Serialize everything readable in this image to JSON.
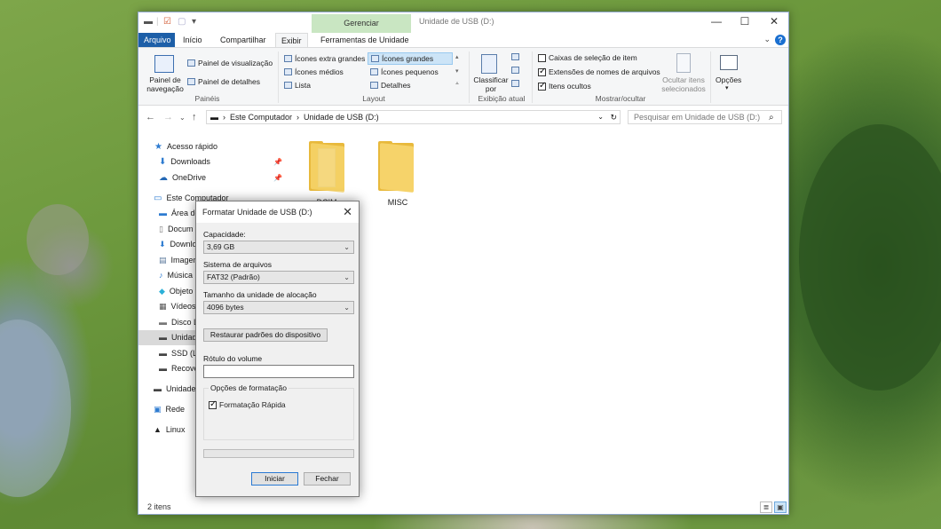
{
  "explorer": {
    "manage_tab": "Gerenciar",
    "window_title": "Unidade de USB (D:)",
    "tabs": {
      "file": "Arquivo",
      "home": "Início",
      "share": "Compartilhar",
      "view": "Exibir",
      "drive_tools": "Ferramentas de Unidade"
    },
    "ribbon": {
      "nav_pane": "Painel de navegação",
      "preview_pane": "Painel de visualização",
      "details_pane": "Painel de detalhes",
      "group_panes": "Painéis",
      "layout_options": {
        "extra_large": "Ícones extra grandes",
        "large": "Ícones grandes",
        "medium": "Ícones médios",
        "small": "Ícones pequenos",
        "list": "Lista",
        "details": "Detalhes"
      },
      "group_layout": "Layout",
      "sort_by": "Classificar por",
      "group_current_view": "Exibição atual",
      "item_checkboxes": "Caixas de seleção de item",
      "file_extensions": "Extensões de nomes de arquivos",
      "hidden_items": "Itens ocultos",
      "hide_selected": "Ocultar itens selecionados",
      "options": "Opções",
      "group_show_hide": "Mostrar/ocultar",
      "checks": {
        "item_checkboxes": false,
        "file_extensions": true,
        "hidden_items": true
      }
    },
    "address": {
      "path_1": "Este Computador",
      "path_2": "Unidade de USB (D:)",
      "search_placeholder": "Pesquisar em Unidade de USB (D:)"
    },
    "sidebar": {
      "quick_access": "Acesso rápido",
      "downloads": "Downloads",
      "onedrive": "OneDrive",
      "this_pc": "Este Computador",
      "desktop": "Área de",
      "documents": "Docum",
      "downloads2": "Downlo",
      "images": "Imagen",
      "music": "Música",
      "objects": "Objeto",
      "videos": "Vídeos",
      "local_disk": "Disco L",
      "usb": "Unidad",
      "ssd": "SSD (L:",
      "recovery": "Recove",
      "usb2": "Unidade",
      "network": "Rede",
      "linux": "Linux"
    },
    "folders": [
      "DCIM",
      "MISC"
    ],
    "status": "2 itens"
  },
  "dialog": {
    "title": "Formatar Unidade de USB (D:)",
    "capacity_label": "Capacidade:",
    "capacity_value": "3,69 GB",
    "fs_label": "Sistema de arquivos",
    "fs_value": "FAT32 (Padrão)",
    "alloc_label": "Tamanho da unidade de alocação",
    "alloc_value": "4096 bytes",
    "restore_button": "Restaurar padrões do dispositivo",
    "volume_label": "Rótulo do volume",
    "volume_value": "",
    "options_legend": "Opções de formatação",
    "quick_format": "Formatação Rápida",
    "quick_format_checked": true,
    "start_button": "Iniciar",
    "close_button": "Fechar"
  }
}
